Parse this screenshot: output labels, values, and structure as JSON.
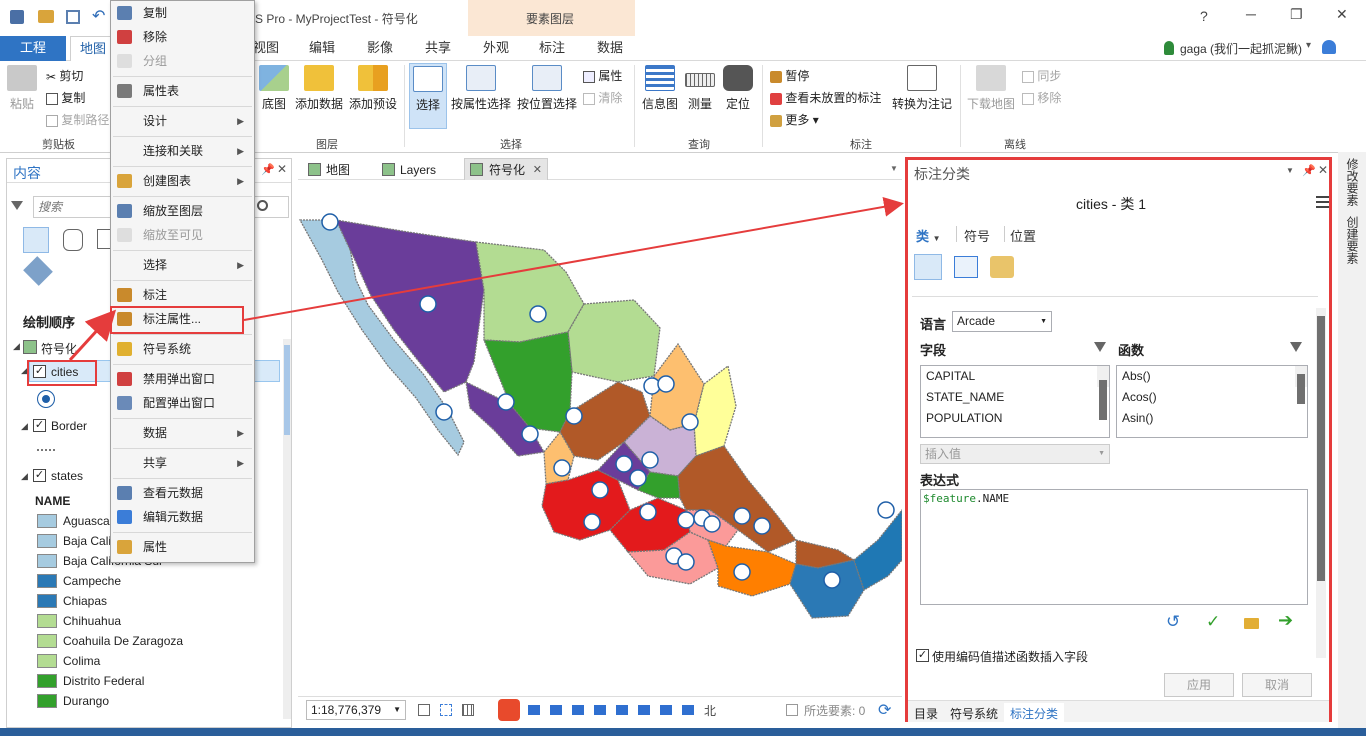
{
  "titlebar": {
    "title": "S Pro - MyProjectTest - 符号化",
    "context_group": "要素图层",
    "help": "?",
    "minimize": "─",
    "restore": "❐",
    "close": "✕"
  },
  "tabs": {
    "project": "工程",
    "map": "地图",
    "view": "视图",
    "edit": "编辑",
    "imagery": "影像",
    "share": "共享",
    "appearance": "外观",
    "labeling": "标注",
    "data": "数据"
  },
  "user": {
    "name": "gaga (我们一起抓泥鳅)",
    "dropdown": "▾"
  },
  "ribbon": {
    "paste": "粘贴",
    "cut": "剪切",
    "copy": "复制",
    "copy_path": "复制路径",
    "clipboard_group": "剪贴板",
    "basemap": "底图",
    "add_data": "添加数据",
    "add_preset": "添加预设",
    "layer_group": "图层",
    "select": "选择",
    "select_by_attr": "按属性选择",
    "select_by_loc": "按位置选择",
    "attributes": "属性",
    "clear": "清除",
    "selection_group": "选择",
    "info": "信息图",
    "measure": "测量",
    "locate": "定位",
    "inquiry_group": "查询",
    "pause": "暂停",
    "view_unplaced": "查看未放置的标注",
    "more": "更多",
    "convert_to_annotation": "转换为注记",
    "labeling_group": "标注",
    "download_map": "下载地图",
    "sync": "同步",
    "remove": "移除",
    "offline_group": "离线"
  },
  "context_menu": {
    "items": [
      {
        "label": "复制",
        "enabled": true,
        "submenu": false
      },
      {
        "label": "移除",
        "enabled": true,
        "submenu": false
      },
      {
        "label": "分组",
        "enabled": false,
        "submenu": false
      },
      {
        "label": "属性表",
        "enabled": true,
        "submenu": false
      },
      {
        "label": "设计",
        "enabled": true,
        "submenu": true
      },
      {
        "label": "连接和关联",
        "enabled": true,
        "submenu": true
      },
      {
        "label": "创建图表",
        "enabled": true,
        "submenu": true
      },
      {
        "label": "缩放至图层",
        "enabled": true,
        "submenu": false
      },
      {
        "label": "缩放至可见",
        "enabled": false,
        "submenu": false
      },
      {
        "label": "选择",
        "enabled": true,
        "submenu": true
      },
      {
        "label": "标注",
        "enabled": true,
        "submenu": false
      },
      {
        "label": "标注属性...",
        "enabled": true,
        "submenu": false
      },
      {
        "label": "符号系统",
        "enabled": true,
        "submenu": false
      },
      {
        "label": "禁用弹出窗口",
        "enabled": true,
        "submenu": false
      },
      {
        "label": "配置弹出窗口",
        "enabled": true,
        "submenu": false
      },
      {
        "label": "数据",
        "enabled": true,
        "submenu": true
      },
      {
        "label": "共享",
        "enabled": true,
        "submenu": true
      },
      {
        "label": "查看元数据",
        "enabled": true,
        "submenu": false
      },
      {
        "label": "编辑元数据",
        "enabled": true,
        "submenu": false
      },
      {
        "label": "属性",
        "enabled": true,
        "submenu": false
      }
    ]
  },
  "contents": {
    "title": "内容",
    "search_placeholder": "搜索",
    "drawing_order": "绘制顺序",
    "map_name": "符号化",
    "layers": {
      "cities": "cities",
      "border": "Border",
      "states": "states"
    },
    "field_header": "NAME",
    "states": [
      {
        "name": "Aguascalientes",
        "color": "#a6cbe0"
      },
      {
        "name": "Baja California",
        "color": "#a6cbe0"
      },
      {
        "name": "Baja California Sur",
        "color": "#a6cbe0"
      },
      {
        "name": "Campeche",
        "color": "#2b79b5"
      },
      {
        "name": "Chiapas",
        "color": "#2b79b5"
      },
      {
        "name": "Chihuahua",
        "color": "#b3dc92"
      },
      {
        "name": "Coahuila De Zaragoza",
        "color": "#b3dc92"
      },
      {
        "name": "Colima",
        "color": "#b3dc92"
      },
      {
        "name": "Distrito Federal",
        "color": "#33a02c"
      },
      {
        "name": "Durango",
        "color": "#33a02c"
      }
    ]
  },
  "map_tabs": {
    "map": "地图",
    "layers": "Layers",
    "symbolize": "符号化",
    "close": "✕"
  },
  "statusbar": {
    "scale": "1:18,776,379",
    "direction": "北",
    "selected": "所选要素: 0"
  },
  "label_pane": {
    "title": "标注分类",
    "class_name": "cities - 类 1",
    "tabs": [
      "类",
      "符号",
      "位置"
    ],
    "language_label": "语言",
    "language_value": "Arcade",
    "fields_label": "字段",
    "functions_label": "函数",
    "fields": [
      "CAPITAL",
      "STATE_NAME",
      "POPULATION"
    ],
    "functions": [
      "Abs()",
      "Acos()",
      "Asin()"
    ],
    "insert_placeholder": "插入值",
    "expression_label": "表达式",
    "expression_var": "$feature",
    "expression_rest": ".NAME",
    "use_coded_values": "使用编码值描述函数插入字段",
    "apply": "应用",
    "cancel": "取消",
    "bottom_tabs": [
      "目录",
      "符号系统",
      "标注分类"
    ]
  },
  "right_strip": {
    "modify": "修改要素",
    "create": "创建要素"
  },
  "map_legend_colors": {
    "purple": "#6a3d9a",
    "light_blue": "#a6cbe0",
    "light_green": "#b3dc92",
    "green": "#33a02c",
    "brown": "#b15928",
    "orange": "#ff7f00",
    "red": "#e31a1c",
    "pink": "#fb9a99",
    "lavender": "#cab2d6",
    "yellow": "#ffff99",
    "peach": "#fdbf6f",
    "blue": "#1f78b4"
  }
}
